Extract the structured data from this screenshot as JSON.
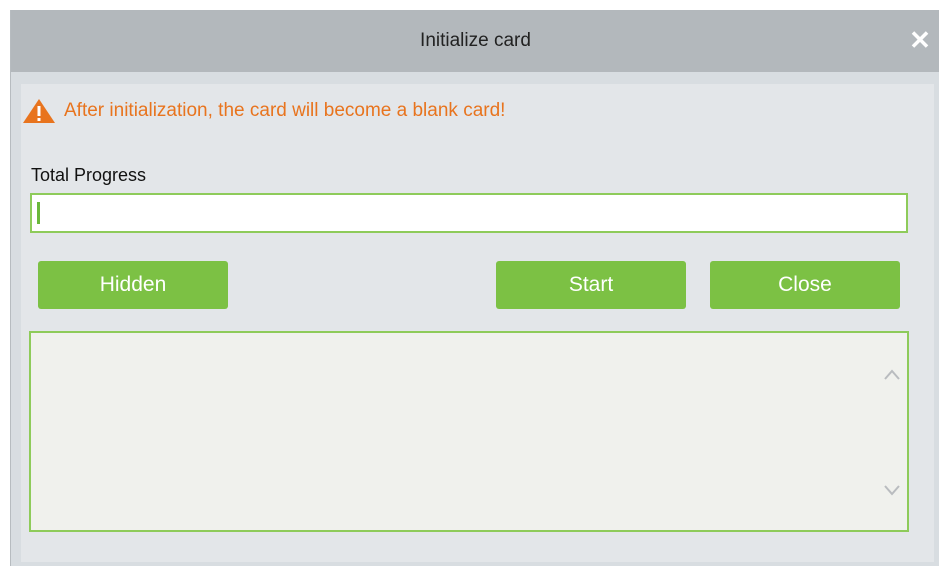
{
  "dialog": {
    "title": "Initialize card",
    "close_icon": "close-icon"
  },
  "warning": {
    "icon": "warning-triangle-icon",
    "text": "After initialization, the card will become a blank card!",
    "color": "#e8741e"
  },
  "progress": {
    "label": "Total Progress",
    "value_fraction": 0.0
  },
  "buttons": {
    "hidden_label": "Hidden",
    "start_label": "Start",
    "close_label": "Close"
  },
  "log": {
    "content": ""
  },
  "colors": {
    "accent": "#7cc144",
    "border": "#8ecb5a",
    "titlebar": "#b3b8bc"
  }
}
